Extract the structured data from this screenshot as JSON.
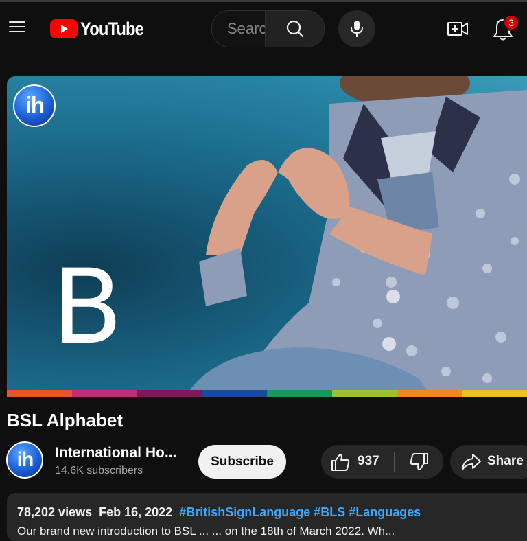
{
  "header": {
    "logo_text": "YouTube",
    "search_placeholder": "Search",
    "notification_count": "3",
    "colors": {
      "brand_red": "#ff0000",
      "badge_red": "#cc0000"
    }
  },
  "player": {
    "letter": "B",
    "channel_logo_text": "ih",
    "progress_colors": [
      "#e8552a",
      "#c0307a",
      "#7a1a5a",
      "#1a4a9a",
      "#1a9a5a",
      "#a0c030",
      "#f08a20",
      "#f0c020"
    ]
  },
  "video": {
    "title": "BSL Alphabet"
  },
  "channel": {
    "avatar_text": "ih",
    "name": "International Ho...",
    "subscribers": "14.6K subscribers"
  },
  "actions": {
    "subscribe_label": "Subscribe",
    "like_count": "937",
    "share_label": "Share"
  },
  "description": {
    "views": "78,202 views",
    "date": "Feb 16, 2022",
    "hashtags": [
      "#BritishSignLanguage",
      "#BLS",
      "#Languages"
    ],
    "text": "Our brand new introduction to BSL ... ... on the 18th of March 2022. Wh..."
  }
}
